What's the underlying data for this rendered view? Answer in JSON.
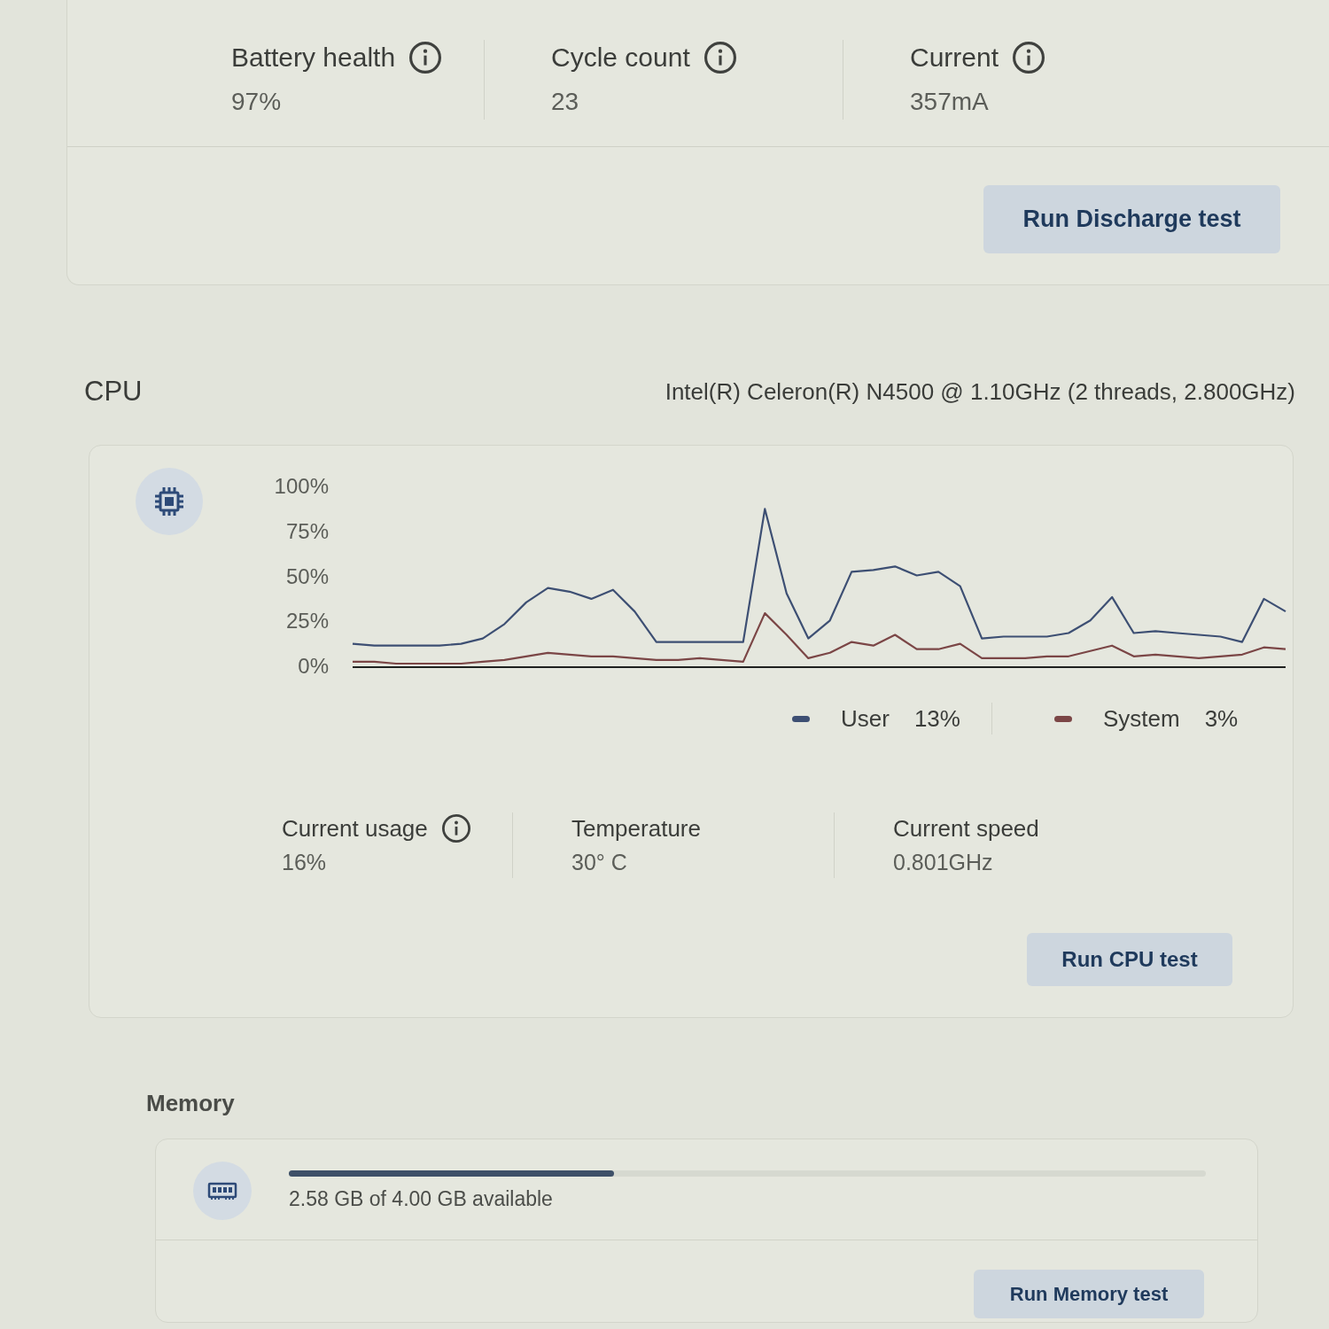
{
  "battery": {
    "stats": [
      {
        "label": "Battery health",
        "info": true,
        "value": "97%"
      },
      {
        "label": "Cycle count",
        "info": true,
        "value": "23"
      },
      {
        "label": "Current",
        "info": true,
        "value": "357mA"
      }
    ],
    "button": "Run Discharge test"
  },
  "cpu": {
    "title": "CPU",
    "model": "Intel(R) Celeron(R) N4500 @ 1.10GHz (2 threads, 2.800GHz)",
    "chart_data": {
      "type": "line",
      "ylim": [
        0,
        100
      ],
      "yticks": [
        {
          "value": 0,
          "label": "0%"
        },
        {
          "value": 25,
          "label": "25%"
        },
        {
          "value": 50,
          "label": "50%"
        },
        {
          "value": 75,
          "label": "75%"
        },
        {
          "value": 100,
          "label": "100%"
        }
      ],
      "series": [
        {
          "name": "User",
          "color": "#3d4f73",
          "values": [
            12,
            11,
            11,
            11,
            11,
            12,
            15,
            23,
            35,
            43,
            41,
            37,
            42,
            30,
            13,
            13,
            13,
            13,
            13,
            87,
            40,
            15,
            25,
            52,
            53,
            55,
            50,
            52,
            44,
            15,
            16,
            16,
            16,
            18,
            25,
            38,
            18,
            19,
            18,
            17,
            16,
            13,
            37,
            30
          ]
        },
        {
          "name": "System",
          "color": "#7b4646",
          "values": [
            2,
            2,
            1,
            1,
            1,
            1,
            2,
            3,
            5,
            7,
            6,
            5,
            5,
            4,
            3,
            3,
            4,
            3,
            2,
            29,
            17,
            4,
            7,
            13,
            11,
            17,
            9,
            9,
            12,
            4,
            4,
            4,
            5,
            5,
            8,
            11,
            5,
            6,
            5,
            4,
            5,
            6,
            10,
            9
          ]
        }
      ]
    },
    "legend": [
      {
        "value": "13%"
      },
      {
        "value": "3%"
      }
    ],
    "stats": [
      {
        "label": "Current usage",
        "info": true,
        "value": "16%"
      },
      {
        "label": "Temperature",
        "info": false,
        "value": "30° C"
      },
      {
        "label": "Current speed",
        "info": false,
        "value": "0.801GHz"
      }
    ],
    "button": "Run CPU test"
  },
  "memory": {
    "title": "Memory",
    "level": 0.355,
    "text": "2.58 GB of 4.00 GB available",
    "button": "Run Memory test"
  }
}
